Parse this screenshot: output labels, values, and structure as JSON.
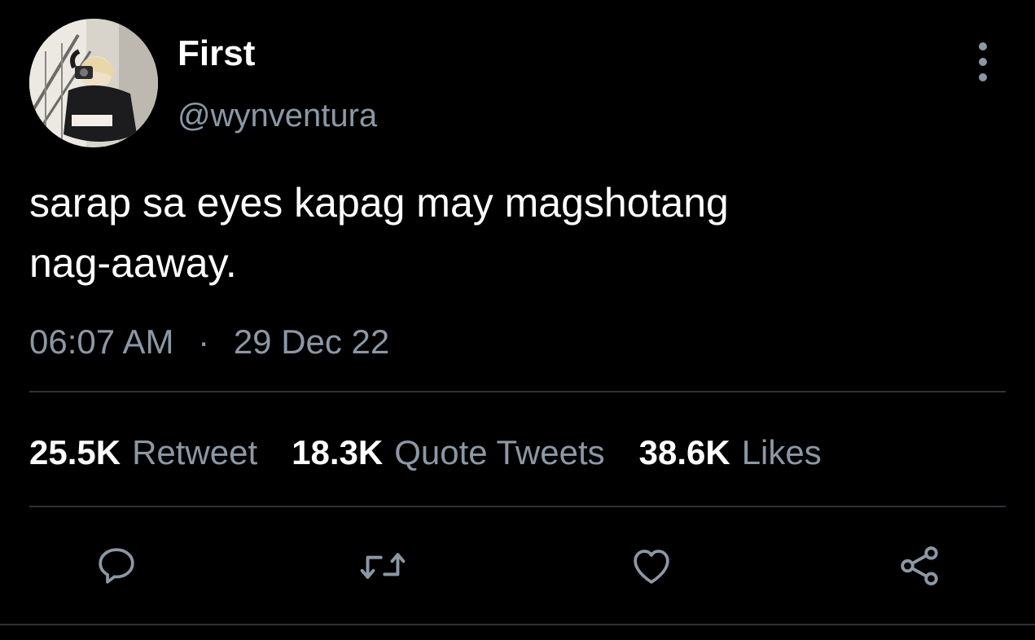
{
  "author": {
    "display_name": "First",
    "handle": "@wynventura"
  },
  "tweet": {
    "text": "sarap sa eyes kapag may magshotang\nnag-aaway.",
    "time": "06:07 AM",
    "separator": "·",
    "date": "29 Dec 22"
  },
  "stats": {
    "retweets": {
      "count": "25.5K",
      "label": "Retweet"
    },
    "quotes": {
      "count": "18.3K",
      "label": "Quote Tweets"
    },
    "likes": {
      "count": "38.6K",
      "label": "Likes"
    }
  },
  "icons": {
    "more": "more-vertical-icon",
    "reply": "reply-icon",
    "retweet": "retweet-icon",
    "like": "heart-icon",
    "share": "share-icon"
  },
  "colors": {
    "background": "#000000",
    "text_primary": "#ffffff",
    "text_secondary": "#8b98a5",
    "divider": "#2f3336"
  }
}
